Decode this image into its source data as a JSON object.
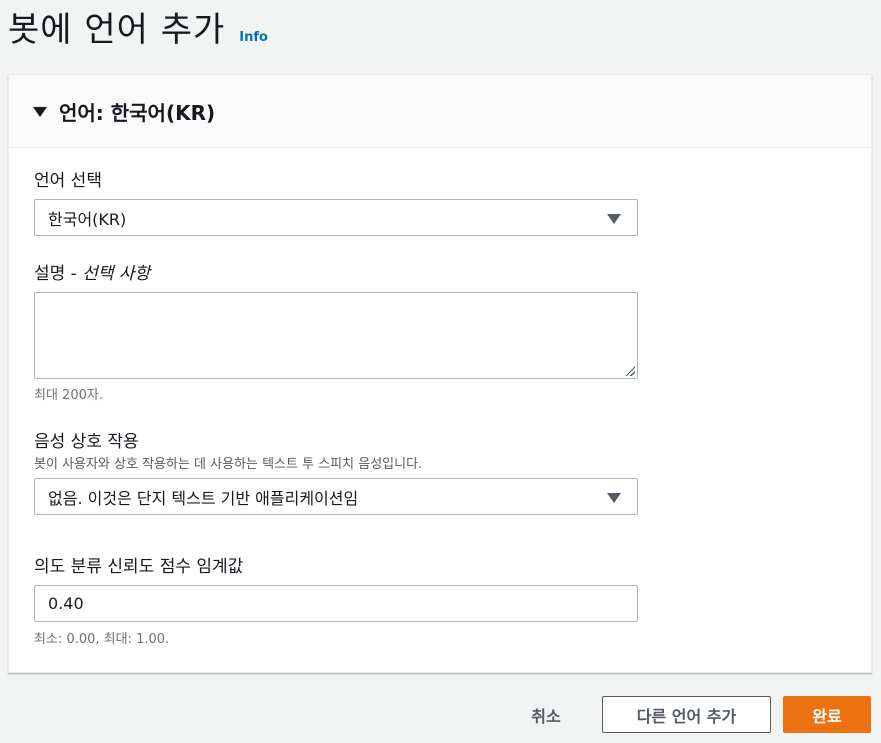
{
  "page": {
    "title": "봇에 언어 추가",
    "info_link": "Info"
  },
  "panel": {
    "title": "언어: 한국어(KR)",
    "language_select": {
      "label": "언어 선택",
      "value": "한국어(KR)"
    },
    "description": {
      "label": "설명 - ",
      "label_optional": "선택 사항",
      "value": "",
      "hint": "최대 200자."
    },
    "voice": {
      "label": "음성 상호 작용",
      "description": "봇이 사용자와 상호 작용하는 데 사용하는 텍스트 투 스피치 음성입니다.",
      "value": "없음. 이것은 단지 텍스트 기반 애플리케이션임"
    },
    "threshold": {
      "label": "의도 분류 신뢰도 점수 임계값",
      "value": "0.40",
      "hint": "최소: 0.00, 최대: 1.00."
    }
  },
  "footer": {
    "cancel_label": "취소",
    "add_language_label": "다른 언어 추가",
    "done_label": "완료"
  },
  "colors": {
    "primary": "#ec7211",
    "link": "#0073bb",
    "background": "#f2f3f3"
  }
}
